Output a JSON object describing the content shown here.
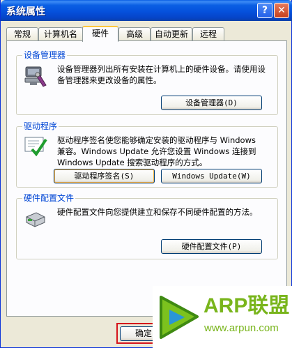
{
  "window": {
    "title": "系统属性"
  },
  "title_buttons": {
    "help": "?",
    "close": "✕"
  },
  "tabs": [
    {
      "label": "常规"
    },
    {
      "label": "计算机名"
    },
    {
      "label": "硬件"
    },
    {
      "label": "高级"
    },
    {
      "label": "自动更新"
    },
    {
      "label": "远程"
    }
  ],
  "active_tab": "硬件",
  "device_manager": {
    "title": "设备管理器",
    "description": "设备管理器列出所有安装在计算机上的硬件设备。请使用设备管理器来更改设备的属性。",
    "button": "设备管理器(D)"
  },
  "drivers": {
    "title": "驱动程序",
    "description": "驱动程序签名使您能够确定安装的驱动程序与 Windows 兼容。Windows Update 允许您设置 Windows 连接到 Windows Update 搜索驱动程序的方式。",
    "signing_button": "驱动程序签名(S)",
    "update_button": "Windows Update(W)"
  },
  "hardware_profiles": {
    "title": "硬件配置文件",
    "description": "硬件配置文件向您提供建立和保存不同硬件配置的方法。",
    "button": "硬件配置文件(P)"
  },
  "bottom": {
    "ok_button": "确定"
  },
  "watermark": {
    "brand": "ARP联盟",
    "url": "www.arpun.com"
  },
  "colors": {
    "group_title": "#0046d5",
    "highlight_border": "#d5141b",
    "watermark_green": "#79b51c"
  }
}
